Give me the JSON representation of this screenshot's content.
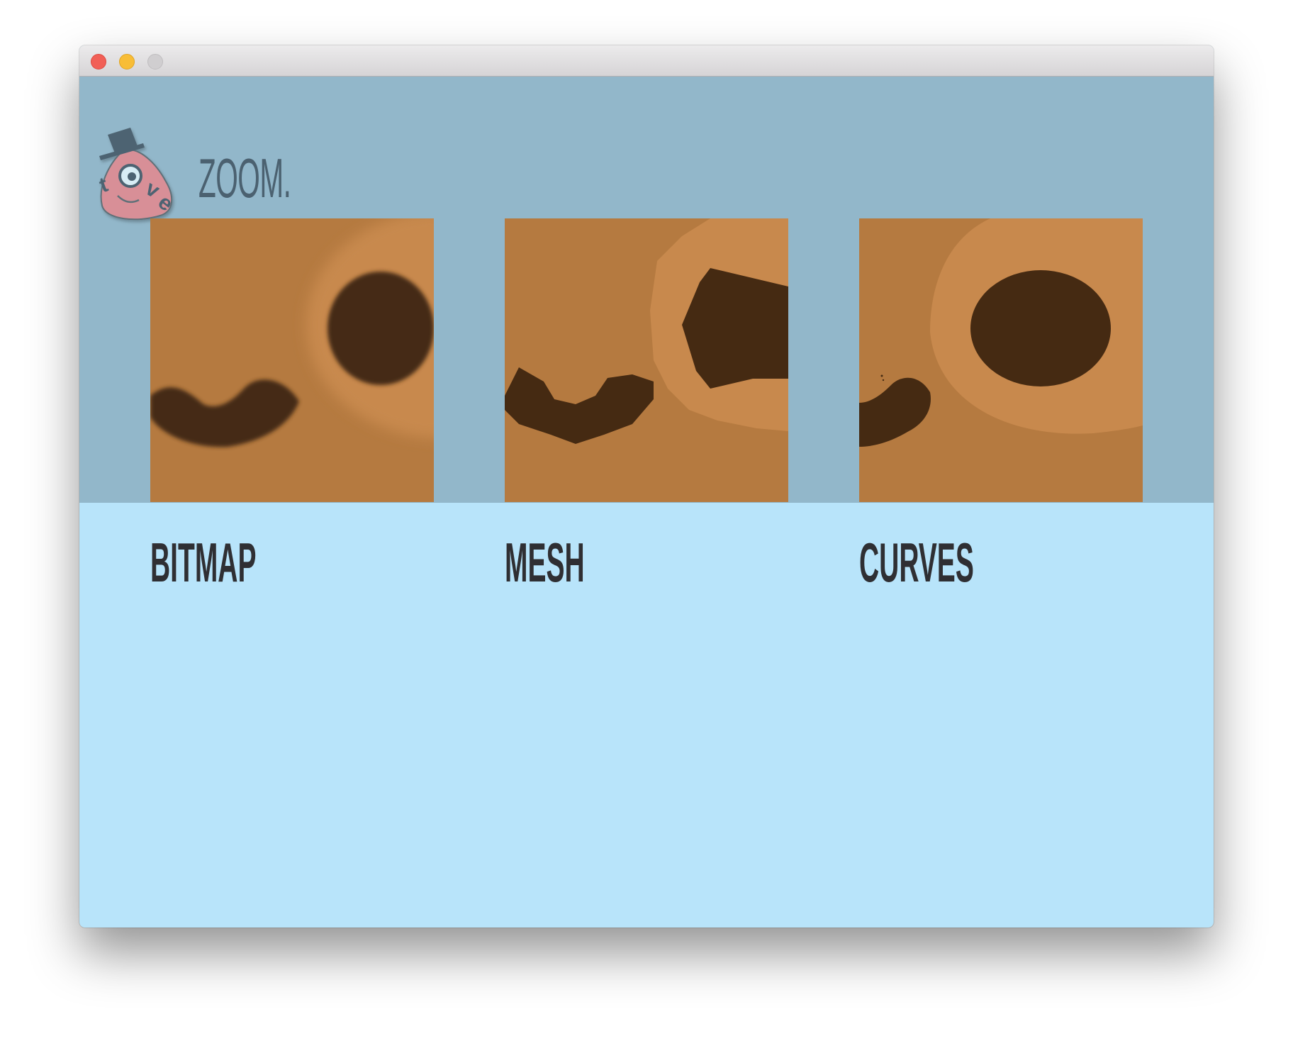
{
  "window": {
    "controls": [
      "close",
      "minimize",
      "zoom"
    ]
  },
  "app": {
    "title": "ZOOM.",
    "logo_text": "tove",
    "logo_icon": "tove-mascot-with-top-hat"
  },
  "panels": [
    {
      "label": "BITMAP"
    },
    {
      "label": "MESH"
    },
    {
      "label": "CURVES"
    }
  ],
  "colors": {
    "header_band": "#92b7ca",
    "content_background": "#b8e4fa",
    "face_skin": "#b57a40",
    "eye_ring": "#c8894d",
    "feature_dark": "#452a12",
    "label_text": "#2f2f33",
    "title_text": "#4b6170"
  }
}
